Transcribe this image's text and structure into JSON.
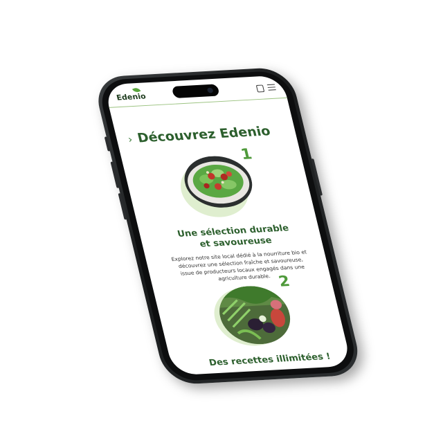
{
  "header": {
    "logo_text": "Edenio",
    "icons": [
      "shopping-bag-icon",
      "menu-icon"
    ]
  },
  "hero": {
    "title": "Découvrez Edenio"
  },
  "steps": [
    {
      "number": "1",
      "image": "salad-bowl-photo",
      "heading_line1": "Une sélection durable",
      "heading_line2": "et savoureuse",
      "text": "Explorez notre site local dédié à la nourriture bio et découvrez une sélection fraîche et savoureuse, issue de producteurs locaux engagés dans une agriculture durable."
    },
    {
      "number": "2",
      "image": "vegetables-basket-photo",
      "heading_line1": "Des recettes illimitées !",
      "text": ""
    }
  ],
  "colors": {
    "accent": "#2c5f2d",
    "number_green": "#4f9a3b",
    "blob": "#dfeecf"
  }
}
